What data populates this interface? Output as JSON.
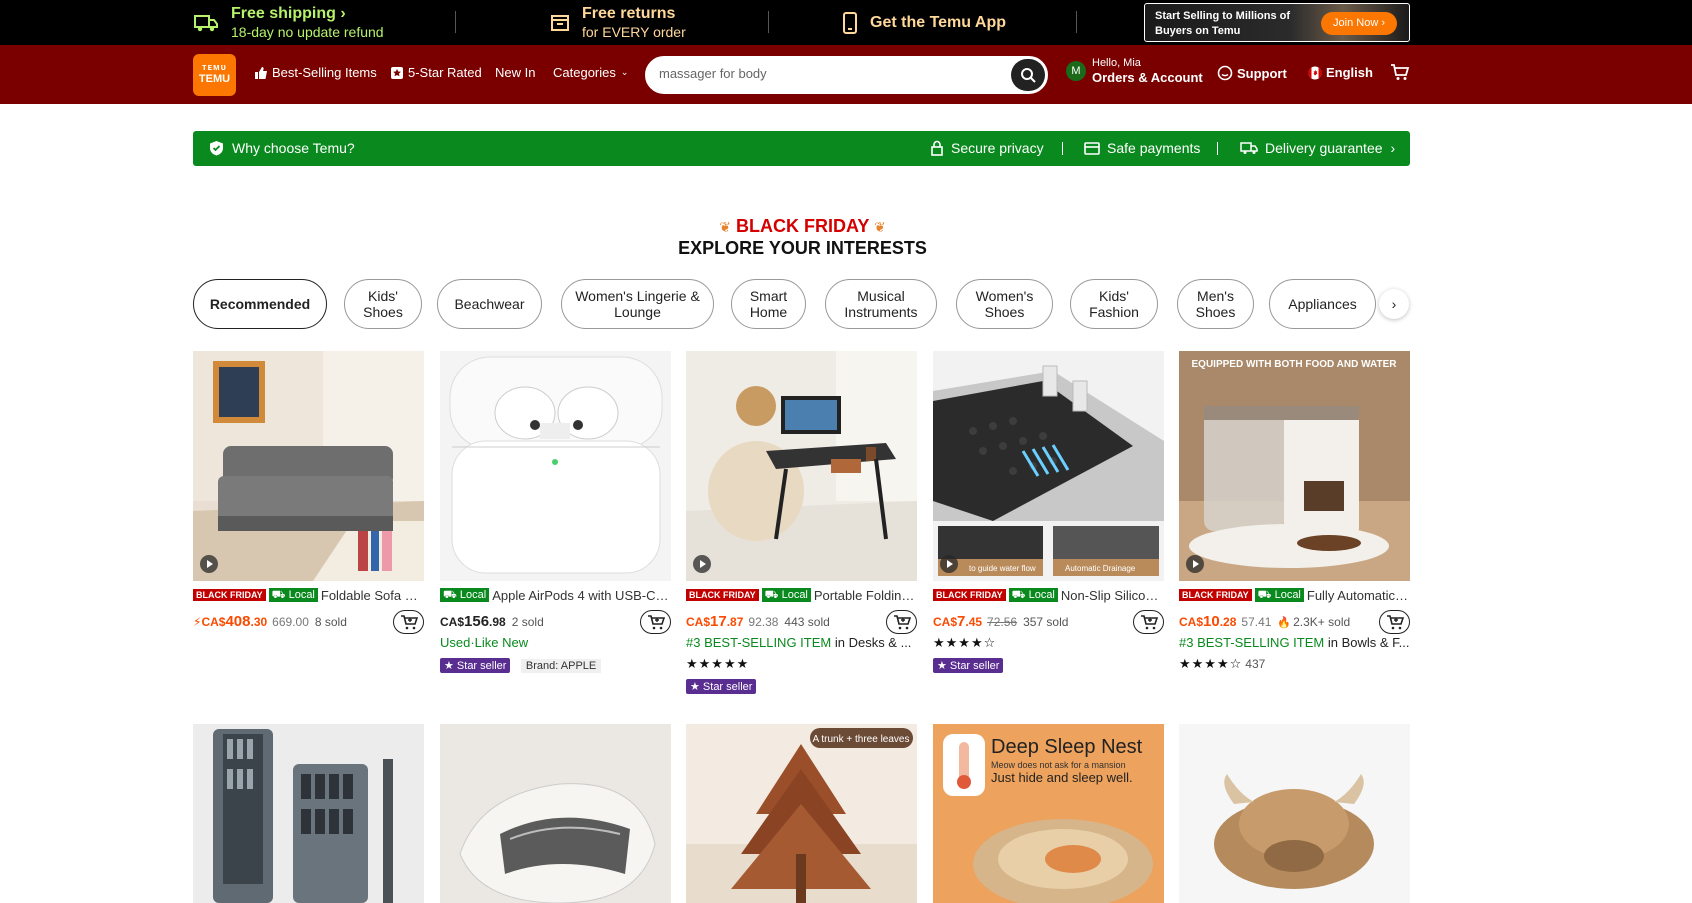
{
  "promo": {
    "shipping_title": "Free shipping",
    "shipping_sub": "18-day no update refund",
    "returns_title": "Free returns",
    "returns_sub": "for EVERY order",
    "app_title": "Get the Temu App",
    "seller_text": "Start Selling to Millions of Buyers on Temu",
    "join_label": "Join Now ›"
  },
  "nav": {
    "logo_top": "ᴛᴇᴍᴜ",
    "logo_bottom": "TEMU",
    "best_selling": "Best-Selling Items",
    "five_star": "5-Star Rated",
    "new_in": "New In",
    "categories": "Categories",
    "search_value": "massager for body",
    "avatar_letter": "M",
    "hello": "Hello, Mia",
    "orders": "Orders & Account",
    "support": "Support",
    "language": "English"
  },
  "why": {
    "title": "Why choose Temu?",
    "items": [
      "Secure privacy",
      "Safe payments",
      "Delivery guarantee"
    ]
  },
  "section": {
    "black_friday": "BLACK FRIDAY",
    "explore": "EXPLORE YOUR INTERESTS"
  },
  "pills": [
    "Recommended",
    "Kids' Shoes",
    "Beachwear",
    "Women's Lingerie & Lounge",
    "Smart Home",
    "Musical Instruments",
    "Women's Shoes",
    "Kids' Fashion",
    "Men's Shoes",
    "Appliances"
  ],
  "labels": {
    "black_friday_tag": "BLACK FRIDAY",
    "local_tag": "Local",
    "star_seller": "Star seller"
  },
  "products": [
    {
      "title": "Foldable Sofa Bed...",
      "price_cur": "CA$",
      "price_int": "408",
      "price_dec": ".30",
      "old_price": "669.00",
      "sold": "8 sold"
    },
    {
      "title": "Apple AirPods 4 with USB-C C...",
      "price_cur": "CA$",
      "price_int": "156",
      "price_dec": ".98",
      "sold": "2 sold",
      "condition": "Used·Like New",
      "brand": "Brand: APPLE"
    },
    {
      "title": "Portable Folding ...",
      "price_cur": "CA$",
      "price_int": "17",
      "price_dec": ".87",
      "old_price": "92.38",
      "sold": "443 sold",
      "rank": "#3 BEST-SELLING ITEM",
      "rank_cat": "in Desks & ..."
    },
    {
      "title": "Non-Slip Silicone ...",
      "price_cur": "CA$",
      "price_int": "7",
      "price_dec": ".45",
      "old_price": "72.56",
      "sold": "357 sold",
      "image_label_1": "to guide water flow",
      "image_label_2": "Automatic Drainage"
    },
    {
      "title": "Fully Automatic 2...",
      "price_cur": "CA$",
      "price_int": "10",
      "price_dec": ".28",
      "old_price": "57.41",
      "sold": "2.3K+ sold",
      "rank": "#3 BEST-SELLING ITEM",
      "rank_cat": "in Bowls & F...",
      "reviews": "437",
      "image_label": "EQUIPPED WITH BOTH FOOD AND WATER"
    }
  ],
  "row2": {
    "tree_label": "A trunk + three leaves",
    "sleep_title": "Deep Sleep Nest",
    "sleep_sub1": "Meow does not ask for a mansion",
    "sleep_sub2": "Just hide and sleep well."
  }
}
